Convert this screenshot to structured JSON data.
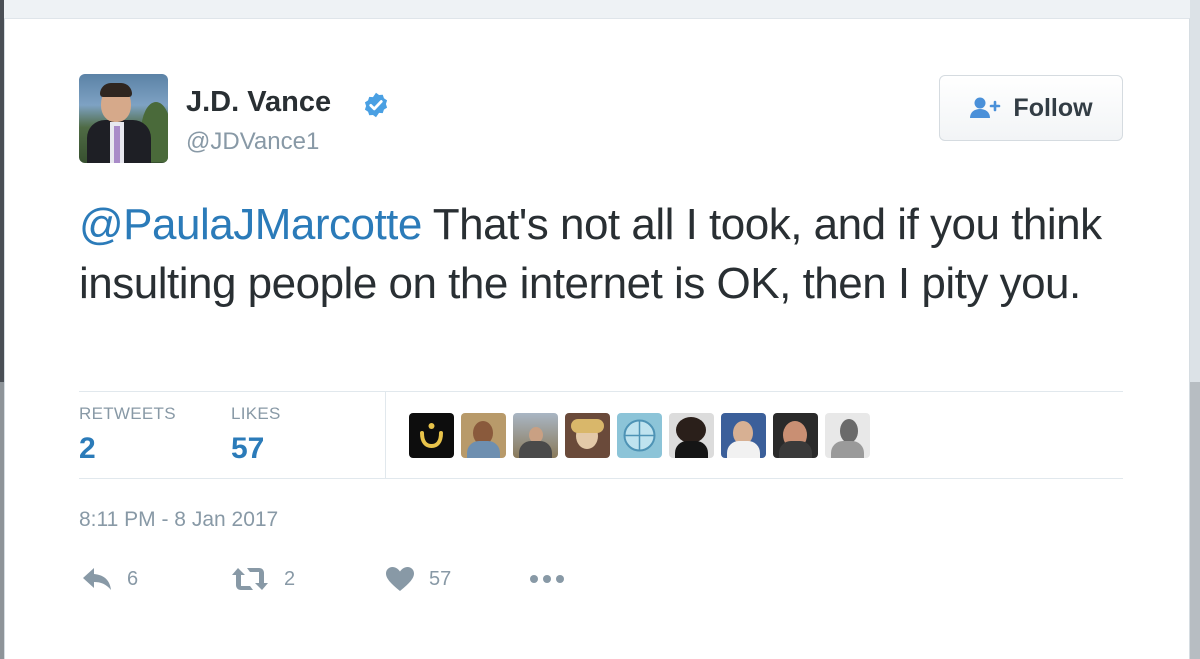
{
  "author": {
    "name": "J.D. Vance",
    "handle": "@JDVance1",
    "verified": true
  },
  "follow_button": {
    "label": "Follow",
    "icon": "add-user-icon"
  },
  "tweet": {
    "mention": "@PaulaJMarcotte",
    "text": " That's not all I took, and if you think insulting people on the internet is OK, then I pity you."
  },
  "stats": {
    "retweets_label": "RETWEETS",
    "retweets_count": "2",
    "likes_label": "LIKES",
    "likes_count": "57"
  },
  "timestamp": "8:11 PM - 8 Jan 2017",
  "actions": {
    "reply_count": "6",
    "retweet_count": "2",
    "like_count": "57"
  },
  "colors": {
    "link": "#2b7bb9",
    "muted": "#8899a6",
    "verified": "#1da1f2"
  }
}
